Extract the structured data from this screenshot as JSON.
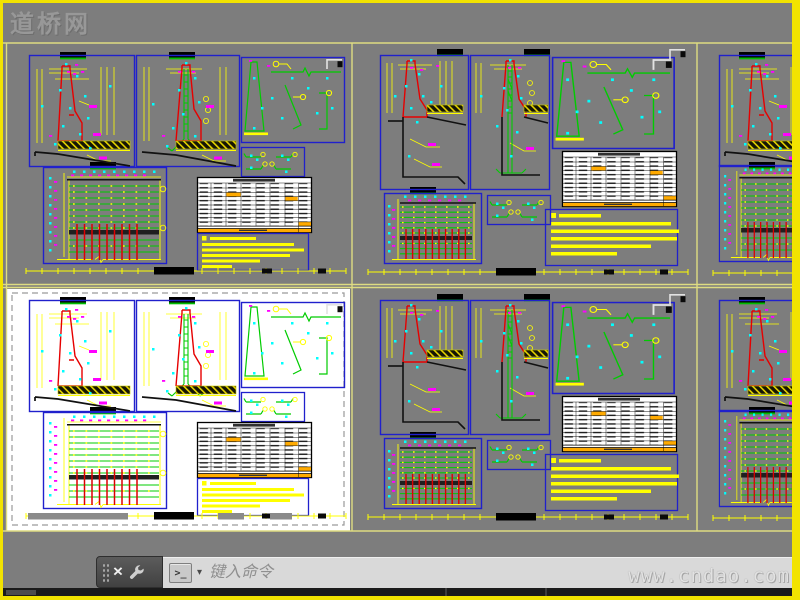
{
  "watermarks": {
    "site_name": "道桥网",
    "site_url": "www.cndao.com"
  },
  "command_bar": {
    "placeholder": "键入命令",
    "close_icon": "×",
    "prompt_icon": ">_",
    "dropdown_icon": "▾"
  },
  "canvas": {
    "background_color": "#7d7d7d",
    "frame_color": "#f2e300",
    "boundary_line_color": "#dedc82",
    "panel_border_color": "#2020cc",
    "drawing_colors": {
      "wall_outline": "#e60000",
      "rebar": "#00cc00",
      "dimension": "#ffff00",
      "tick_marks": "#00ffff",
      "labels": "#ff00ff",
      "table_highlight": "#ffaa00",
      "paper": "#ffffff"
    }
  },
  "sheets": [
    {
      "id": "sheet-top-left",
      "row": 1,
      "col": 1,
      "selected": false,
      "background": "gray"
    },
    {
      "id": "sheet-top-middle",
      "row": 1,
      "col": 2,
      "selected": false,
      "background": "gray"
    },
    {
      "id": "sheet-top-right",
      "row": 1,
      "col": 3,
      "selected": false,
      "background": "gray",
      "clipped": true
    },
    {
      "id": "sheet-bottom-left",
      "row": 2,
      "col": 1,
      "selected": true,
      "background": "white"
    },
    {
      "id": "sheet-bottom-middle",
      "row": 2,
      "col": 2,
      "selected": false,
      "background": "gray"
    },
    {
      "id": "sheet-bottom-right",
      "row": 2,
      "col": 3,
      "selected": false,
      "background": "gray",
      "clipped": true
    }
  ]
}
